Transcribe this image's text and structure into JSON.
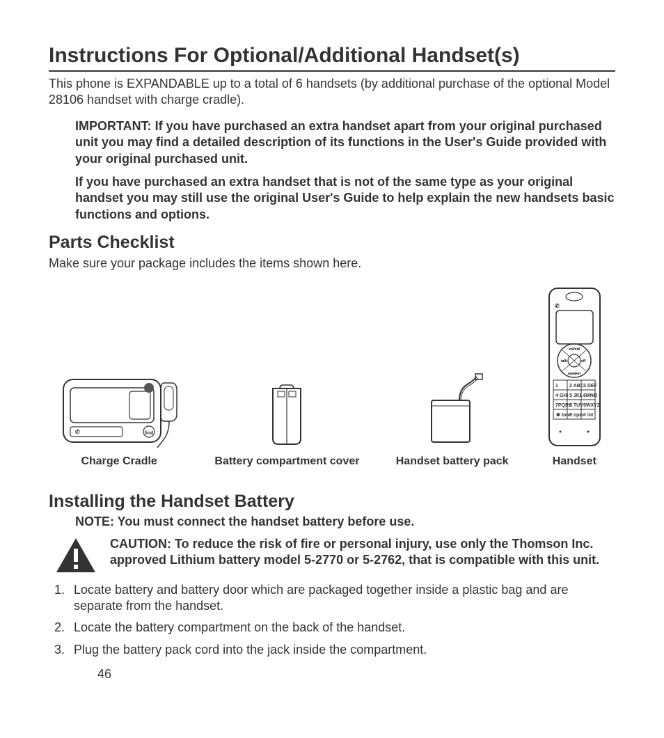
{
  "page_number": "46",
  "title": "Instructions For Optional/Additional Handset(s)",
  "intro": "This phone is EXPANDABLE up to a total of 6 handsets (by additional purchase of the optional Model 28106 handset with charge cradle).",
  "important_p1": "IMPORTANT: If you have purchased an extra handset apart from your original purchased unit you may find a detailed description of its functions in the User's Guide provided with your original purchased unit.",
  "important_p2": "If you have purchased an extra handset that is not of the same type as your original handset you may still use the original User's Guide to help explain the new handsets basic functions and options.",
  "parts_heading": "Parts Checklist",
  "parts_sub": "Make sure your package includes the items shown here.",
  "parts": {
    "cradle": "Charge Cradle",
    "cover": "Battery compartment cover",
    "pack": "Handset battery pack",
    "handset": "Handset"
  },
  "install_heading": "Installing the Handset Battery",
  "install_note": "NOTE: You must connect the handset battery before use.",
  "caution": "CAUTION: To reduce the risk of fire or personal injury, use only the Thomson Inc. approved Lithium battery model 5-2770 or 5-2762, that is compatible with this unit.",
  "steps": [
    "Locate battery and battery door which are packaged together inside a plastic bag and are separate from the handset.",
    "Locate the battery compartment on the back of the handset.",
    "Plug the battery pack cord into the jack inside  the compartment."
  ]
}
